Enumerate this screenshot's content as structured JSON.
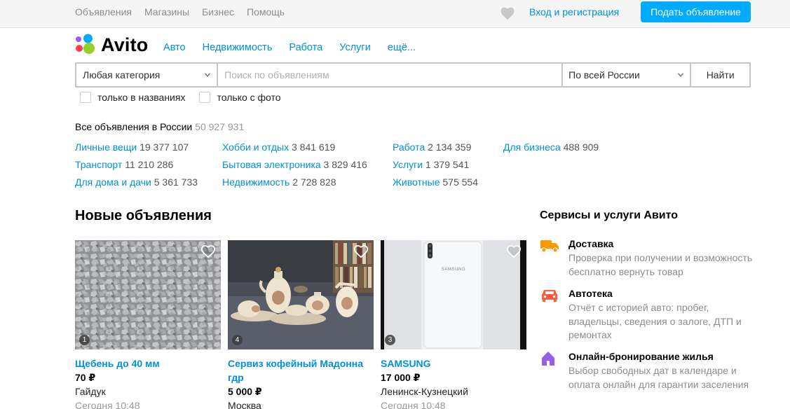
{
  "topbar": {
    "nav": [
      "Объявления",
      "Магазины",
      "Бизнес",
      "Помощь"
    ],
    "login": "Вход и регистрация",
    "post_button": "Подать объявление"
  },
  "logo": {
    "text": "Avito",
    "colors": [
      "#00aaff",
      "#965eeb",
      "#ff4053",
      "#97cf26"
    ]
  },
  "mainnav": [
    "Авто",
    "Недвижимость",
    "Работа",
    "Услуги",
    "ещё..."
  ],
  "search": {
    "category": "Любая категория",
    "placeholder": "Поиск по объявлениям",
    "value": "",
    "region": "По всей России",
    "button": "Найти",
    "only_titles": "только в названиях",
    "only_photo": "только с фото"
  },
  "totals": {
    "label": "Все объявления в России",
    "count": "50 927 931"
  },
  "categories": [
    [
      {
        "name": "Личные вещи",
        "count": "19 377 107"
      },
      {
        "name": "Транспорт",
        "count": "11 210 286"
      },
      {
        "name": "Для дома и дачи",
        "count": "5 361 733"
      }
    ],
    [
      {
        "name": "Хобби и отдых",
        "count": "3 841 619"
      },
      {
        "name": "Бытовая электроника",
        "count": "3 829 416"
      },
      {
        "name": "Недвижимость",
        "count": "2 728 828"
      }
    ],
    [
      {
        "name": "Работа",
        "count": "2 134 359"
      },
      {
        "name": "Услуги",
        "count": "1 379 541"
      },
      {
        "name": "Животные",
        "count": "575 554"
      }
    ],
    [
      {
        "name": "Для бизнеса",
        "count": "488 909"
      }
    ]
  ],
  "listings": {
    "title": "Новые объявления",
    "items": [
      {
        "title": "Щебень до 40 мм",
        "price": "70 ₽",
        "location": "Гайдук",
        "date": "Сегодня 10:48",
        "photos": "1",
        "image": "gravel"
      },
      {
        "title": "Сервиз кофейный Мадонна гдр",
        "price": "5 000 ₽",
        "location": "Москва",
        "date": "",
        "photos": "4",
        "image": "tea-set"
      },
      {
        "title": "SAMSUNG",
        "price": "17 000 ₽",
        "location": "Ленинск-Кузнецкий",
        "date": "Сегодня 10:48",
        "photos": "3",
        "image": "phone",
        "image_brand": "SAMSUNG"
      }
    ]
  },
  "services": {
    "title": "Сервисы и услуги Авито",
    "items": [
      {
        "icon": "truck-icon",
        "color": "#ff9800",
        "title": "Доставка",
        "desc": "Проверка при получении и возможность бесплатно вернуть товар"
      },
      {
        "icon": "car-icon",
        "color": "#ff5f3f",
        "title": "Автотека",
        "desc": "Отчёт с историей авто: пробег, владельцы, сведения о залоге, ДТП и ремонтах"
      },
      {
        "icon": "house-icon",
        "color": "#965eeb",
        "title": "Онлайн-бронирование жилья",
        "desc": "Выбор свободных дат в календаре и оплата онлайн для гарантии заселения"
      }
    ]
  }
}
